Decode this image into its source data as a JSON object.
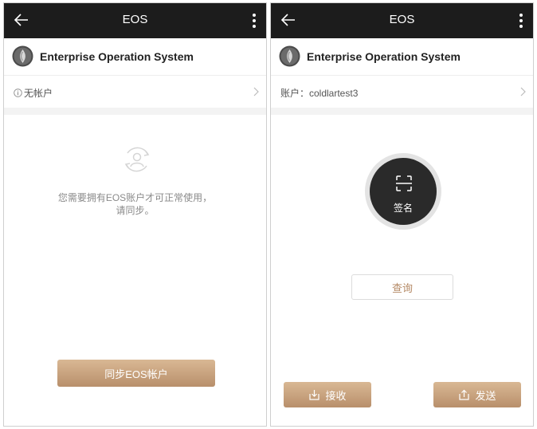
{
  "topbar": {
    "title": "EOS"
  },
  "app": {
    "name": "Enterprise Operation System"
  },
  "left": {
    "account_text": "无帐户",
    "empty_message_line1": "您需要拥有EOS账户才可正常使用，",
    "empty_message_line2": "请同步。",
    "sync_button": "同步EOS帐户"
  },
  "right": {
    "account_text": "账户：coldlartest3",
    "sign_label": "签名",
    "query_button": "查询",
    "receive_button": "接收",
    "send_button": "发送"
  },
  "colors": {
    "topbar_bg": "#1c1c1c",
    "accent_gold": "#c8a07e",
    "sign_circle": "#2a2a2a"
  },
  "icons": {
    "back": "arrow-left-icon",
    "more": "more-vertical-icon",
    "logo": "eos-logo-icon",
    "info": "info-icon",
    "chevron": "chevron-right-icon",
    "empty": "user-sync-icon",
    "scan": "scan-icon",
    "receive": "download-icon",
    "send": "upload-icon"
  }
}
